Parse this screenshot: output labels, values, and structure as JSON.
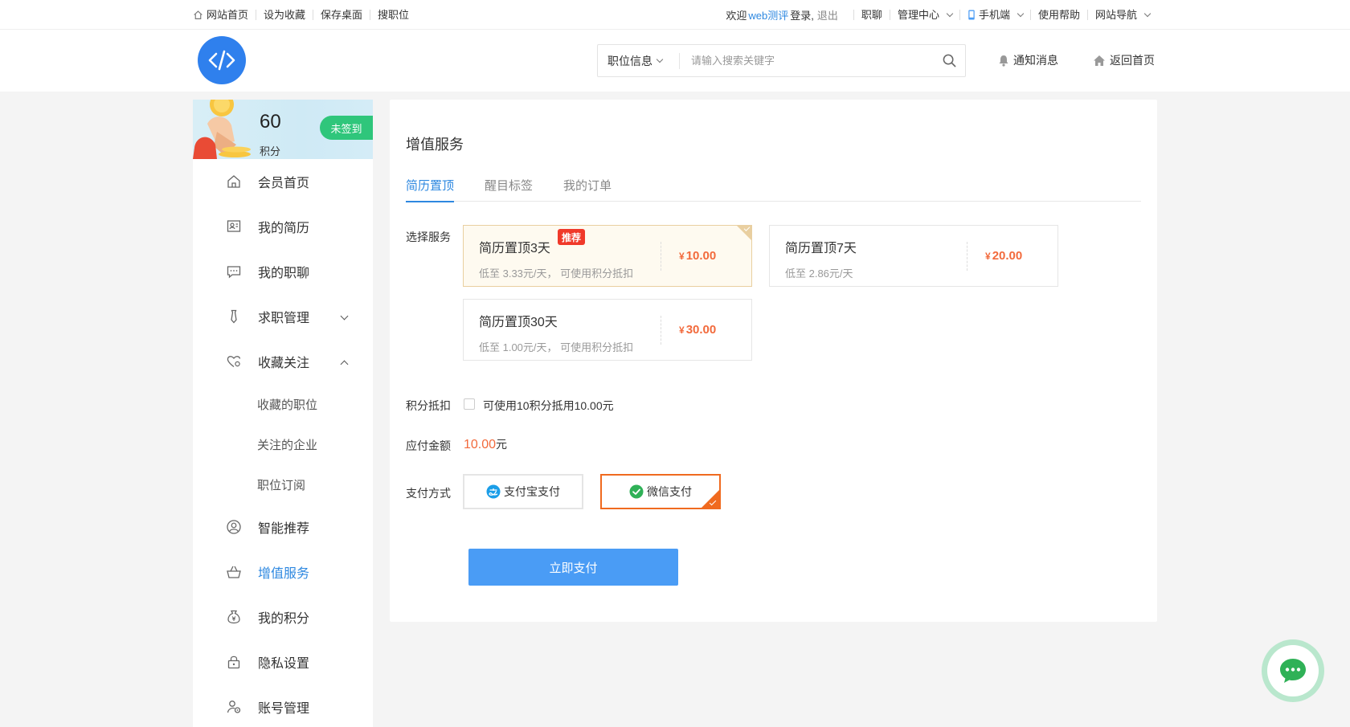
{
  "topbar": {
    "left_links": [
      "网站首页",
      "设为收藏",
      "保存桌面",
      "搜职位"
    ],
    "welcome_prefix": "欢迎",
    "site_name": "web测评",
    "welcome_suffix": "登录,",
    "logout": "退出",
    "right_links": [
      {
        "label": "职聊",
        "dropdown": false
      },
      {
        "label": "管理中心",
        "dropdown": true
      },
      {
        "label": "手机端",
        "dropdown": true
      },
      {
        "label": "使用帮助",
        "dropdown": false
      },
      {
        "label": "网站导航",
        "dropdown": true
      }
    ]
  },
  "header": {
    "search_type": "职位信息",
    "search_placeholder": "请输入搜索关键字",
    "notify": "通知消息",
    "home": "返回首页"
  },
  "sidebar": {
    "points": {
      "value": "60",
      "unit": "积分",
      "sign_label": "未签到"
    },
    "items": [
      {
        "label": "会员首页",
        "icon": "home-icon"
      },
      {
        "label": "我的简历",
        "icon": "resume-icon"
      },
      {
        "label": "我的职聊",
        "icon": "chat-icon"
      },
      {
        "label": "求职管理",
        "icon": "tie-icon",
        "expand": "down"
      },
      {
        "label": "收藏关注",
        "icon": "heart-icon",
        "expand": "up"
      },
      {
        "label": "收藏的职位",
        "sub": true
      },
      {
        "label": "关注的企业",
        "sub": true
      },
      {
        "label": "职位订阅",
        "sub": true
      },
      {
        "label": "智能推荐",
        "icon": "user-circle-icon"
      },
      {
        "label": "增值服务",
        "icon": "basket-icon",
        "active": true
      },
      {
        "label": "我的积分",
        "icon": "money-bag-icon"
      },
      {
        "label": "隐私设置",
        "icon": "lock-icon"
      },
      {
        "label": "账号管理",
        "icon": "account-gear-icon"
      }
    ]
  },
  "main": {
    "title": "增值服务",
    "tabs": [
      "简历置顶",
      "醒目标签",
      "我的订单"
    ],
    "select_label": "选择服务",
    "services": [
      {
        "name": "简历置顶3天",
        "badge": "推荐",
        "desc": "低至 3.33元/天， 可使用积分抵扣",
        "yen": "¥",
        "price": "10.00",
        "selected": true
      },
      {
        "name": "简历置顶7天",
        "badge": "",
        "desc": "低至 2.86元/天",
        "yen": "¥",
        "price": "20.00",
        "selected": false
      },
      {
        "name": "简历置顶30天",
        "badge": "",
        "desc": "低至 1.00元/天， 可使用积分抵扣",
        "yen": "¥",
        "price": "30.00",
        "selected": false
      }
    ],
    "points_label": "积分抵扣",
    "points_text": "可使用10积分抵用10.00元",
    "amount_label": "应付金额",
    "amount_value": "10.00",
    "amount_unit": "元",
    "pay_label": "支付方式",
    "pay_methods": [
      {
        "label": "支付宝支付",
        "icon": "alipay-icon",
        "selected": false
      },
      {
        "label": "微信支付",
        "icon": "wechat-check-icon",
        "selected": true
      }
    ],
    "submit_label": "立即支付"
  },
  "colors": {
    "accent": "#2e88e0",
    "price": "#f26a3c",
    "pay_selected": "#f06a1f",
    "button": "#4a9cf5",
    "sign": "#2fc67b"
  }
}
